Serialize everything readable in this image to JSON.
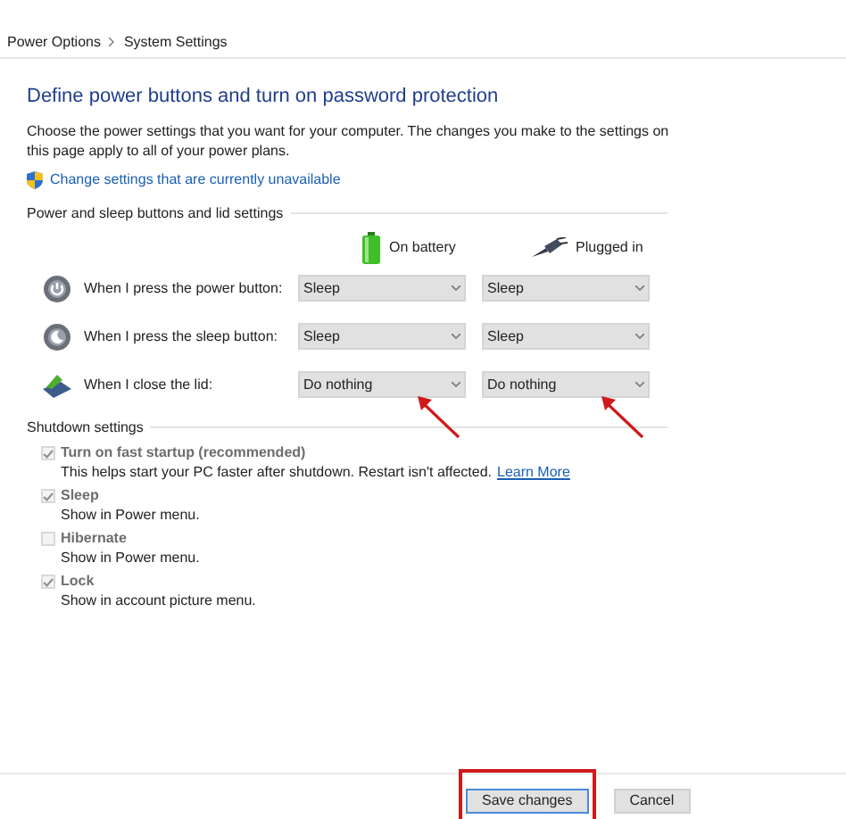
{
  "breadcrumb": [
    "Power Options",
    "System Settings"
  ],
  "title": "Define power buttons and turn on password protection",
  "description": "Choose the power settings that you want for your computer. The changes you make to the settings on this page apply to all of your power plans.",
  "admin_link": "Change settings that are currently unavailable",
  "buttons_section": {
    "title": "Power and sleep buttons and lid settings",
    "columns": [
      {
        "kind": "battery",
        "label": "On battery"
      },
      {
        "kind": "plug",
        "label": "Plugged in"
      }
    ],
    "rows": [
      {
        "kind": "power",
        "label": "When I press the power button:",
        "values": [
          "Sleep",
          "Sleep"
        ],
        "highlighted": false
      },
      {
        "kind": "sleep",
        "label": "When I press the sleep button:",
        "values": [
          "Sleep",
          "Sleep"
        ],
        "highlighted": false
      },
      {
        "kind": "lid",
        "label": "When I close the lid:",
        "values": [
          "Do nothing",
          "Do nothing"
        ],
        "highlighted": true
      }
    ]
  },
  "shutdown_section": {
    "title": "Shutdown settings",
    "options": [
      {
        "label": "Turn on fast startup (recommended)",
        "description": "This helps start your PC faster after shutdown. Restart isn't affected.",
        "link": "Learn More",
        "checked": true,
        "disabled": true
      },
      {
        "label": "Sleep",
        "description": "Show in Power menu.",
        "checked": true,
        "disabled": true
      },
      {
        "label": "Hibernate",
        "description": "Show in Power menu.",
        "checked": false,
        "disabled": true
      },
      {
        "label": "Lock",
        "description": "Show in account picture menu.",
        "checked": true,
        "disabled": true
      }
    ]
  },
  "footer": {
    "buttons": [
      {
        "label": "Save changes",
        "primary": true,
        "highlighted": true
      },
      {
        "label": "Cancel",
        "primary": false,
        "highlighted": false
      }
    ]
  }
}
